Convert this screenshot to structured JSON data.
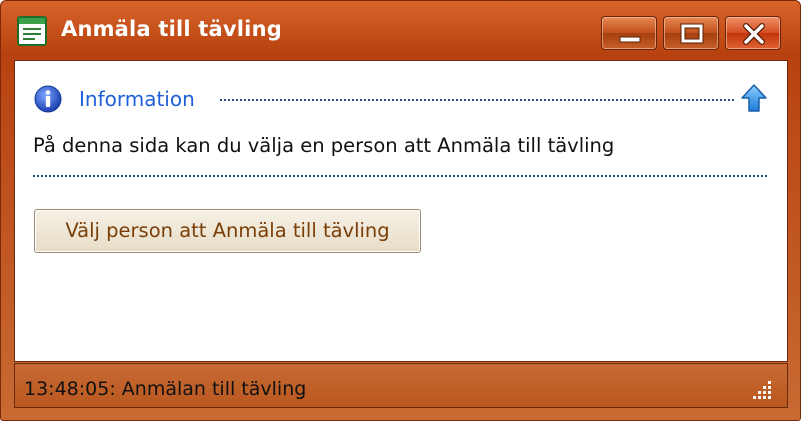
{
  "window": {
    "title": "Anmäla till tävling",
    "title_icon": "form-icon",
    "controls": {
      "minimize_icon": "minimize-icon",
      "maximize_icon": "maximize-icon",
      "close_icon": "close-icon"
    },
    "accent_color": "#b8420f"
  },
  "info_panel": {
    "icon": "info-icon",
    "title": "Information",
    "collapse_icon": "arrow-up-icon",
    "body_text": "På denna sida kan du välja en person att Anmäla till tävling",
    "title_color": "#1f5fd8"
  },
  "actions": {
    "select_person_label": "Välj person att Anmäla till tävling"
  },
  "statusbar": {
    "message": "13:48:05: Anmälan till tävling",
    "grip_icon": "resize-grip-icon"
  }
}
